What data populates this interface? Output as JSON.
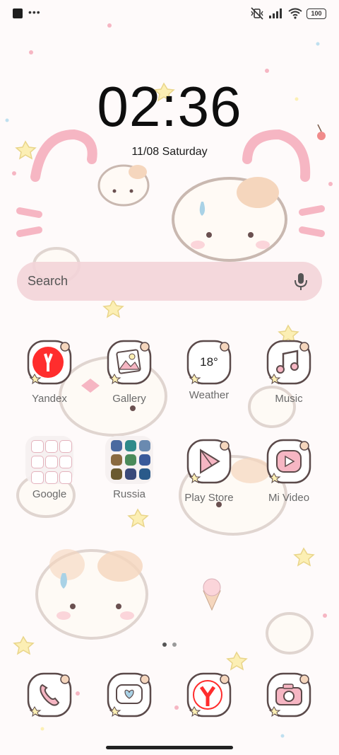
{
  "status_bar": {
    "battery": "100",
    "icons": [
      "app-notification-icon",
      "more-dots-icon",
      "vibrate-off-icon",
      "signal-icon",
      "wifi-icon",
      "battery-icon"
    ]
  },
  "lockscreen": {
    "time": "02:36",
    "date": "11/08 Saturday"
  },
  "search": {
    "placeholder": "Search"
  },
  "apps_row1": [
    {
      "label": "Yandex",
      "icon": "yandex-icon"
    },
    {
      "label": "Gallery",
      "icon": "gallery-icon"
    },
    {
      "label": "Weather",
      "icon": "weather-icon",
      "badge": "18°"
    },
    {
      "label": "Music",
      "icon": "music-icon"
    }
  ],
  "apps_row2": [
    {
      "label": "Google",
      "icon": "google-folder-icon"
    },
    {
      "label": "Russia",
      "icon": "russia-folder-icon"
    },
    {
      "label": "Play Store",
      "icon": "play-store-icon"
    },
    {
      "label": "Mi Video",
      "icon": "mi-video-icon"
    }
  ],
  "dock": [
    {
      "icon": "phone-icon"
    },
    {
      "icon": "messages-icon"
    },
    {
      "icon": "yandex-browser-icon"
    },
    {
      "icon": "camera-icon"
    }
  ],
  "page_indicator": {
    "pages": 2,
    "current": 1
  },
  "colors": {
    "icon_outline": "#5b4a4a",
    "icon_fill": "#ffffff",
    "pink": "#f0b9c6",
    "yandex_red": "#ff2d2d",
    "search_bg": "#f3d4d8"
  }
}
